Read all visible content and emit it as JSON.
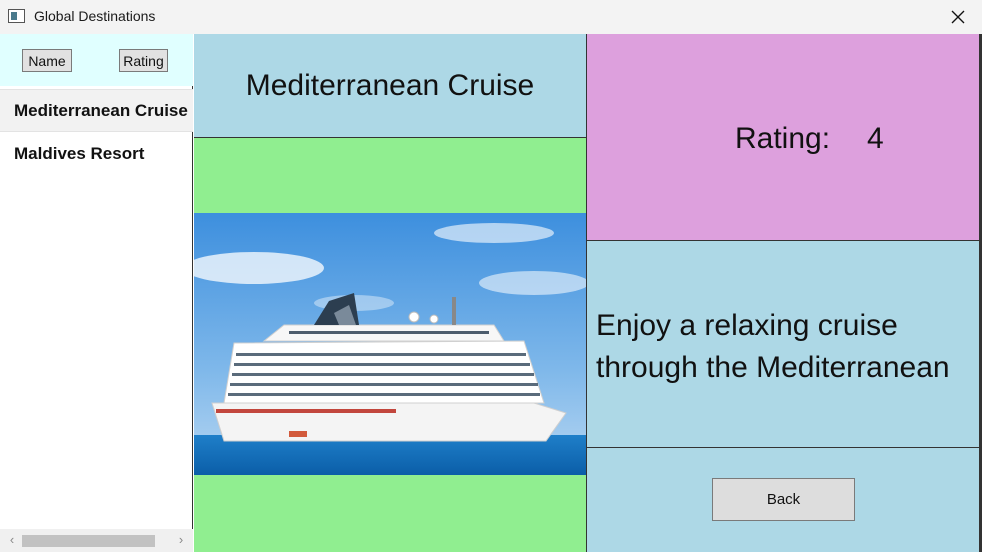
{
  "window": {
    "title": "Global Destinations",
    "icon": "app-window-icon",
    "close_icon": "close-icon"
  },
  "sidebar": {
    "sort_buttons": {
      "name_label": "Name",
      "rating_label": "Rating"
    },
    "items": [
      {
        "label": "Mediterranean Cruise",
        "selected": true
      },
      {
        "label": "Maldives Resort",
        "selected": false
      }
    ],
    "scrollbar": {
      "left_arrow": "‹",
      "right_arrow": "›"
    }
  },
  "detail": {
    "title": "Mediterranean Cruise",
    "rating_label": "Rating:",
    "rating_value": "4",
    "description": "Enjoy a relaxing cruise through the Mediterranean",
    "image": "cruise-ship-photo",
    "back_label": "Back"
  },
  "colors": {
    "title_bg": "#add8e6",
    "image_bg": "#90ee90",
    "rating_bg": "#dda0dd",
    "description_bg": "#add8e6",
    "sort_bar_bg": "#e0ffff"
  }
}
